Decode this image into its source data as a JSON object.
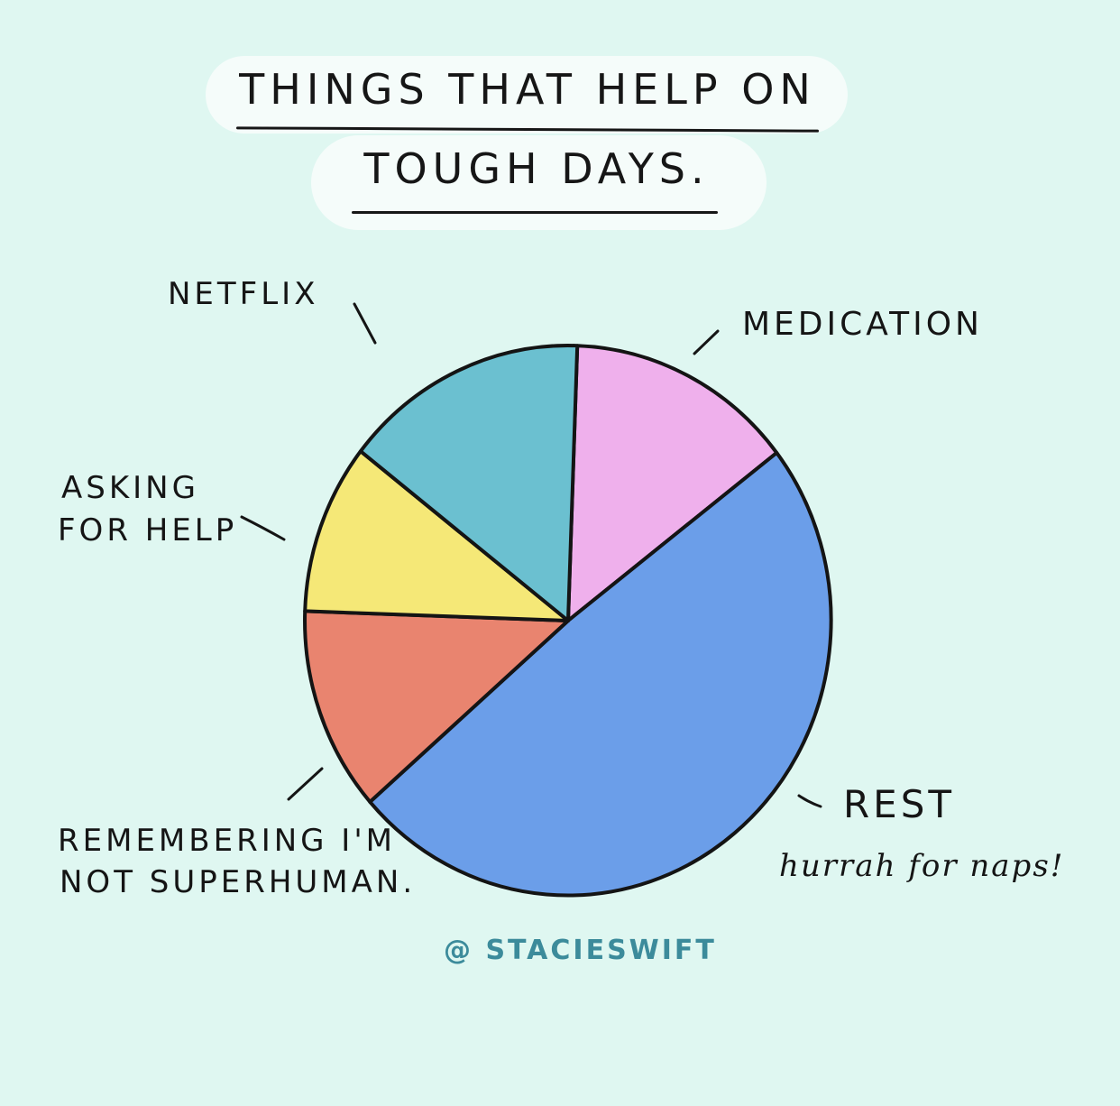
{
  "chart_data": {
    "type": "pie",
    "title_line1": "THINGS THAT HELP ON",
    "title_line2": "TOUGH DAYS.",
    "slices": [
      {
        "label": "MEDICATION",
        "value": 14,
        "color": "#efb0ec"
      },
      {
        "label": "REST",
        "value": 49,
        "color": "#6b9ee9"
      },
      {
        "label": "REMEMBERING I'M NOT SUPERHUMAN.",
        "value": 12,
        "color": "#e9846f"
      },
      {
        "label": "ASKING FOR HELP",
        "value": 10,
        "color": "#f5e877"
      },
      {
        "label": "NETFLIX",
        "value": 15,
        "color": "#6bc0d0"
      }
    ]
  },
  "labels": {
    "netflix": "NETFLIX",
    "medication": "MEDICATION",
    "asking_1": "ASKING",
    "asking_2": "FOR HELP",
    "remembering_1": "REMEMBERING I'M",
    "remembering_2": "NOT SUPERHUMAN.",
    "rest": "REST",
    "rest_note": "hurrah for naps!"
  },
  "credit": "@ STACIESWIFT"
}
